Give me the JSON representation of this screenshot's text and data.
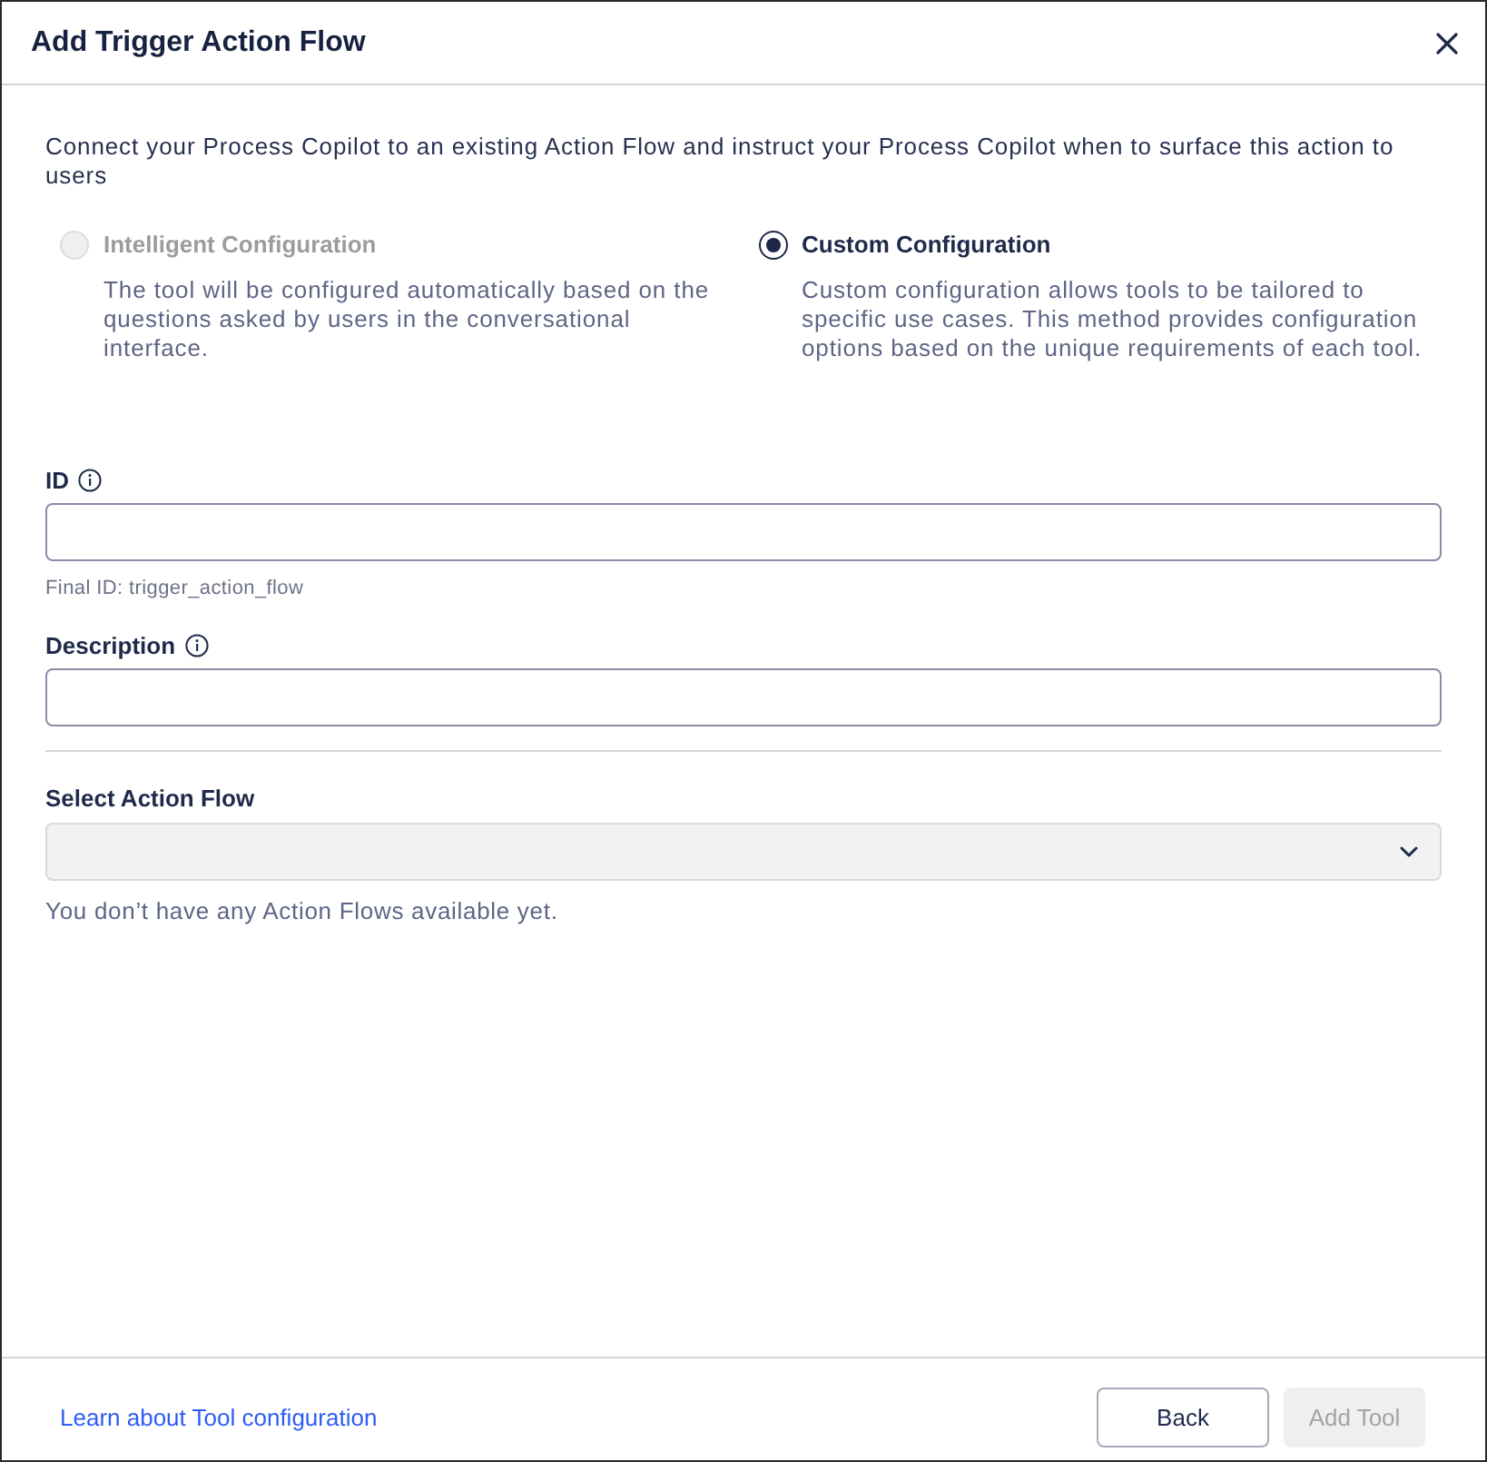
{
  "window": {
    "title": "Add Trigger Action Flow"
  },
  "intro": "Connect your Process Copilot to an existing Action Flow and instruct your Process Copilot when to surface this action to users",
  "configuration_options": [
    {
      "label": "Intelligent Configuration",
      "description": "The tool will be configured automatically based on the questions asked by users in the conversational interface.",
      "selected": false,
      "disabled": true
    },
    {
      "label": "Custom Configuration",
      "description": "Custom configuration allows tools to be tailored to specific use cases. This method provides configuration options based on the unique requirements of each tool.",
      "selected": true,
      "disabled": false
    }
  ],
  "sections": [
    {
      "fields": [
        {
          "kind": "text",
          "label": "ID",
          "info": true,
          "disabled": false,
          "hint": "Final ID: trigger_action_flow"
        },
        {
          "kind": "text",
          "label": "Description",
          "info": true,
          "disabled": false
        }
      ]
    },
    {
      "fields": [
        {
          "kind": "select",
          "label": "Select Action Flow",
          "info": false,
          "disabled": true,
          "hint": "You don’t have any Action Flows available yet."
        }
      ]
    }
  ],
  "footer": {
    "link": "Learn about Tool configuration",
    "buttons": [
      {
        "label": "Back",
        "kind": "secondary",
        "disabled": false
      },
      {
        "label": "Add Tool",
        "kind": "primary",
        "disabled": true
      }
    ]
  }
}
